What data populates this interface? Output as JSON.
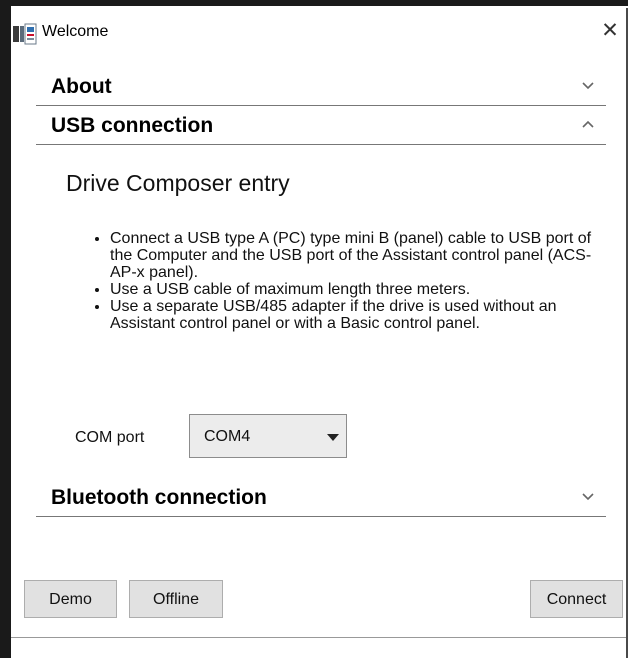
{
  "window": {
    "title": "Welcome"
  },
  "sections": {
    "about": {
      "title": "About"
    },
    "usb": {
      "title": "USB connection"
    },
    "bluetooth": {
      "title": "Bluetooth connection"
    }
  },
  "usb_content": {
    "heading": "Drive Composer entry",
    "bullets": [
      "Connect a USB type A (PC) type mini B (panel) cable to USB port of the Computer and the USB port of the Assistant control panel (ACS-AP-x panel).",
      "Use a USB cable of maximum length three meters.",
      "Use a separate USB/485 adapter if the drive is used without an Assistant control panel or with a Basic control panel."
    ],
    "com_port_label": "COM port",
    "com_port_value": "COM4"
  },
  "buttons": {
    "demo": "Demo",
    "offline": "Offline",
    "connect": "Connect"
  },
  "icons": {
    "app": "abb-app-icon",
    "close": "close-icon",
    "chevron_down": "chevron-down-icon",
    "chevron_up": "chevron-up-icon"
  }
}
